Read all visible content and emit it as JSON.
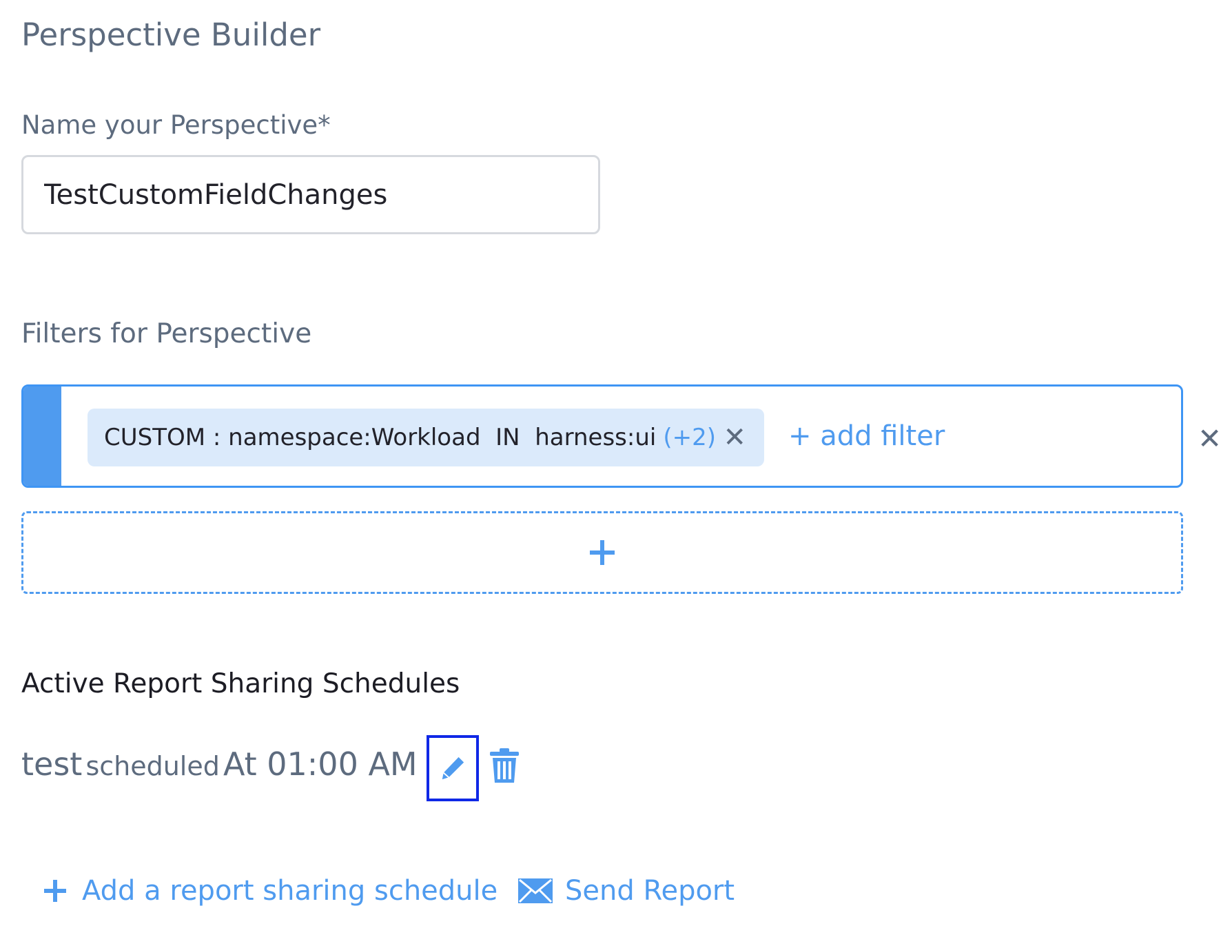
{
  "page": {
    "title": "Perspective Builder"
  },
  "name_field": {
    "label": "Name your Perspective*",
    "value": "TestCustomFieldChanges"
  },
  "filters": {
    "label": "Filters for Perspective",
    "chip": {
      "text": "CUSTOM : namespace:Workload  IN  harness:ui",
      "extra": "(+2)",
      "remove_icon": "close-icon"
    },
    "add_filter_label": "+ add filter",
    "clear_icon": "close-icon",
    "add_group_icon": "plus-icon"
  },
  "schedules": {
    "title": "Active Report Sharing Schedules",
    "items": [
      {
        "name": "test",
        "status_word": "scheduled",
        "time": "At 01:00 AM",
        "edit_icon": "pencil-icon",
        "delete_icon": "trash-icon"
      }
    ]
  },
  "actions": {
    "add_schedule_label": "Add a report sharing schedule",
    "send_report_label": "Send Report"
  },
  "colors": {
    "accent": "#4f9bef",
    "chip_bg": "#dbeafb",
    "focus_outline": "#0f28e6"
  }
}
